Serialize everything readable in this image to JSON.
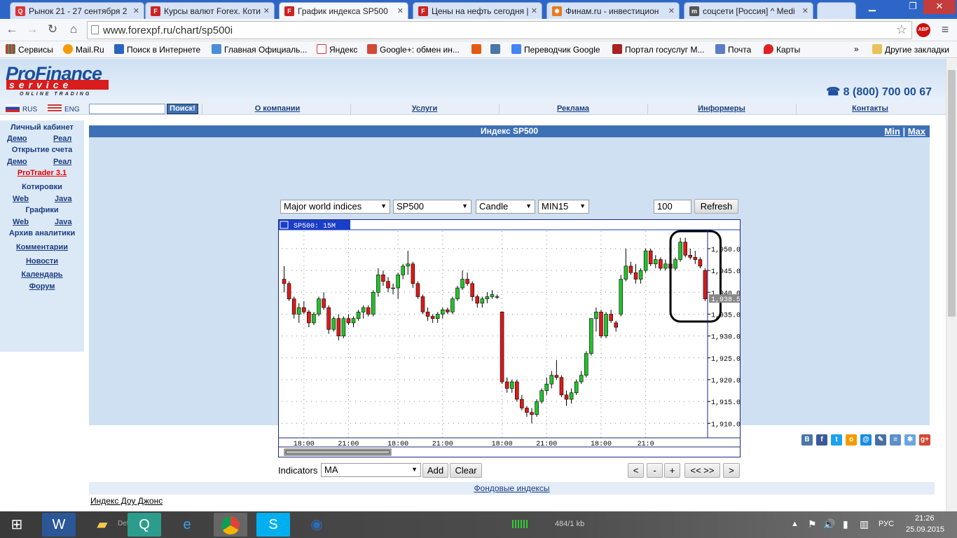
{
  "browser": {
    "tabs": [
      {
        "title": "Рынок 21 - 27 сентября 2",
        "icon": "qf-icon",
        "active": false
      },
      {
        "title": "Курсы валют Forex. Коти",
        "icon": "pf-icon",
        "active": false
      },
      {
        "title": "График индекса SP500",
        "icon": "pf-icon",
        "active": true
      },
      {
        "title": "Цены на нефть сегодня |",
        "icon": "pf-icon",
        "active": false
      },
      {
        "title": "Финам.ru - инвестицион",
        "icon": "finam-icon",
        "active": false
      },
      {
        "title": "соцсети [Россия] ^ Medi",
        "icon": "m-icon",
        "active": false
      }
    ],
    "url": "www.forexpf.ru/chart/sp500i",
    "bookmarks": [
      "Сервисы",
      "Mail.Ru",
      "Поиск в Интернете",
      "Главная Официаль...",
      "Яндекс",
      "Google+: обмен ин...",
      "",
      "",
      "Переводчик Google",
      "Портал госуслуг М...",
      "Почта",
      "Карты"
    ],
    "bookmarks_more": "»",
    "other_bookmarks": "Другие закладки",
    "abp_badge": "ABP"
  },
  "site": {
    "logo_top": "ProFinance",
    "logo_mid": "service",
    "logo_bottom": "ONLINE TRADING",
    "phone": "8 (800) 700 00 67",
    "lang_ru": "RUS",
    "lang_en": "ENG",
    "search_button": "Поиск!",
    "nav": [
      "О компании",
      "Услуги",
      "Реклама",
      "Информеры",
      "Контакты"
    ]
  },
  "sidebar": {
    "cabinet": "Личный кабинет",
    "demo1": "Демо",
    "real1": "Реал",
    "open_account": "Открытие счета",
    "demo2": "Демо",
    "real2": "Реал",
    "protrader": "ProTrader 3.1",
    "quotes": "Котировки",
    "web1": "Web",
    "java1": "Java",
    "charts": "Графики",
    "web2": "Web",
    "java2": "Java",
    "archive": "Архив аналитики",
    "comments": "Комментарии",
    "news": "Новости",
    "calendar": "Календарь",
    "forum": "Форум"
  },
  "main": {
    "title": "Индекс SP500",
    "min": "Min",
    "sep": "|",
    "max": "Max",
    "group_select": "Major world indices",
    "symbol_select": "SP500",
    "type_select": "Candle",
    "period_select": "MIN15",
    "count": "100",
    "refresh": "Refresh",
    "indicators_label": "Indicators",
    "indicator_select": "MA",
    "add": "Add",
    "clear": "Clear",
    "nav_prev": "<",
    "nav_minus": "-",
    "nav_plus": "+",
    "nav_expand": "<< >>",
    "nav_next": ">"
  },
  "chart_data": {
    "type": "candlestick",
    "legend": "SP500: 15M",
    "ylim": [
      1907,
      1954
    ],
    "y_ticks": [
      "1,910.00",
      "1,915.00",
      "1,920.00",
      "1,925.00",
      "1,930.00",
      "1,935.00",
      "1,940.00",
      "1,945.00",
      "1,950.00"
    ],
    "y_tick_values": [
      1910,
      1915,
      1920,
      1925,
      1930,
      1935,
      1940,
      1945,
      1950
    ],
    "x_ticks": [
      "18:00",
      "21:00",
      "18:00",
      "21:00",
      "18:00",
      "21:00",
      "18:00",
      "21:0"
    ],
    "x_tick_bars": [
      4,
      13,
      23,
      32,
      44,
      53,
      64,
      73
    ],
    "last_price_label": "1,938.57",
    "last_price": 1938.57,
    "candles": [
      [
        1943.0,
        1946.0,
        1940.0,
        1942.0
      ],
      [
        1942.0,
        1942.5,
        1938.0,
        1938.5
      ],
      [
        1938.5,
        1939.0,
        1934.0,
        1935.0
      ],
      [
        1935.0,
        1937.5,
        1933.0,
        1936.5
      ],
      [
        1936.5,
        1938.0,
        1935.0,
        1935.5
      ],
      [
        1935.5,
        1936.0,
        1932.0,
        1933.0
      ],
      [
        1933.0,
        1935.5,
        1932.5,
        1935.0
      ],
      [
        1935.0,
        1939.0,
        1934.5,
        1938.5
      ],
      [
        1938.5,
        1940.0,
        1936.0,
        1936.5
      ],
      [
        1936.5,
        1937.0,
        1930.5,
        1931.5
      ],
      [
        1931.5,
        1934.5,
        1931.0,
        1934.0
      ],
      [
        1934.0,
        1935.0,
        1929.0,
        1930.0
      ],
      [
        1930.0,
        1934.5,
        1929.5,
        1934.0
      ],
      [
        1934.0,
        1935.0,
        1932.5,
        1933.0
      ],
      [
        1933.0,
        1934.5,
        1932.0,
        1934.0
      ],
      [
        1934.0,
        1936.0,
        1933.5,
        1935.5
      ],
      [
        1935.5,
        1937.0,
        1934.0,
        1936.5
      ],
      [
        1936.5,
        1937.0,
        1934.5,
        1935.0
      ],
      [
        1935.0,
        1940.5,
        1934.5,
        1940.0
      ],
      [
        1940.0,
        1945.5,
        1939.0,
        1944.0
      ],
      [
        1944.0,
        1945.0,
        1941.5,
        1942.5
      ],
      [
        1942.5,
        1943.5,
        1940.0,
        1941.0
      ],
      [
        1941.0,
        1942.0,
        1939.5,
        1941.0
      ],
      [
        1941.0,
        1944.5,
        1938.5,
        1944.0
      ],
      [
        1944.0,
        1946.5,
        1943.0,
        1946.0
      ],
      [
        1946.0,
        1949.5,
        1944.0,
        1946.5
      ],
      [
        1946.5,
        1947.0,
        1941.0,
        1942.0
      ],
      [
        1942.0,
        1942.5,
        1938.5,
        1939.0
      ],
      [
        1939.0,
        1939.5,
        1935.0,
        1935.5
      ],
      [
        1935.5,
        1936.5,
        1933.5,
        1934.5
      ],
      [
        1934.5,
        1935.0,
        1933.0,
        1934.0
      ],
      [
        1934.0,
        1935.5,
        1933.0,
        1935.0
      ],
      [
        1935.0,
        1936.5,
        1934.0,
        1936.0
      ],
      [
        1936.0,
        1936.5,
        1935.0,
        1935.5
      ],
      [
        1935.5,
        1939.0,
        1935.0,
        1938.5
      ],
      [
        1938.5,
        1941.5,
        1938.0,
        1941.0
      ],
      [
        1941.0,
        1945.0,
        1940.5,
        1943.0
      ],
      [
        1943.0,
        1944.5,
        1941.5,
        1942.0
      ],
      [
        1942.0,
        1942.5,
        1938.0,
        1939.0
      ],
      [
        1939.0,
        1939.5,
        1936.5,
        1937.5
      ],
      [
        1937.5,
        1939.0,
        1936.5,
        1938.5
      ],
      [
        1938.5,
        1940.0,
        1937.5,
        1939.0
      ],
      [
        1939.0,
        1940.5,
        1938.5,
        1939.5
      ],
      [
        1939.0,
        1939.5,
        1938.5,
        1939.0
      ],
      [
        1935.5,
        1935.5,
        1919.0,
        1919.5
      ],
      [
        1919.5,
        1920.5,
        1917.0,
        1918.0
      ],
      [
        1918.0,
        1920.0,
        1917.0,
        1919.5
      ],
      [
        1919.5,
        1920.0,
        1915.0,
        1915.5
      ],
      [
        1915.5,
        1916.5,
        1913.0,
        1913.5
      ],
      [
        1913.5,
        1914.0,
        1911.5,
        1912.5
      ],
      [
        1912.5,
        1913.5,
        1910.0,
        1912.0
      ],
      [
        1912.0,
        1915.5,
        1911.5,
        1915.0
      ],
      [
        1915.0,
        1918.0,
        1914.5,
        1917.5
      ],
      [
        1917.5,
        1920.5,
        1916.5,
        1919.0
      ],
      [
        1919.0,
        1922.0,
        1918.0,
        1921.0
      ],
      [
        1921.0,
        1924.5,
        1920.0,
        1920.5
      ],
      [
        1920.5,
        1921.0,
        1916.0,
        1916.5
      ],
      [
        1916.5,
        1917.5,
        1914.0,
        1915.5
      ],
      [
        1915.5,
        1918.0,
        1914.5,
        1917.0
      ],
      [
        1917.0,
        1920.0,
        1916.5,
        1919.5
      ],
      [
        1919.5,
        1922.0,
        1919.0,
        1921.0
      ],
      [
        1921.0,
        1926.5,
        1920.5,
        1926.0
      ],
      [
        1926.0,
        1934.0,
        1925.5,
        1934.0
      ],
      [
        1934.0,
        1936.5,
        1931.0,
        1935.5
      ],
      [
        1935.5,
        1936.0,
        1929.5,
        1930.0
      ],
      [
        1930.0,
        1935.5,
        1929.5,
        1935.0
      ],
      [
        1935.0,
        1936.0,
        1933.0,
        1933.5
      ],
      [
        1933.0,
        1933.5,
        1931.0,
        1932.0
      ],
      [
        1935.0,
        1944.0,
        1934.5,
        1943.0
      ],
      [
        1943.0,
        1950.0,
        1942.5,
        1946.0
      ],
      [
        1946.0,
        1947.0,
        1944.0,
        1944.5
      ],
      [
        1944.5,
        1946.5,
        1942.0,
        1943.0
      ],
      [
        1943.0,
        1945.5,
        1942.0,
        1945.0
      ],
      [
        1945.0,
        1950.0,
        1944.5,
        1949.5
      ],
      [
        1949.5,
        1950.0,
        1946.0,
        1946.5
      ],
      [
        1946.5,
        1948.5,
        1945.5,
        1947.5
      ],
      [
        1947.5,
        1948.0,
        1945.0,
        1945.5
      ],
      [
        1945.5,
        1947.5,
        1945.0,
        1946.5
      ],
      [
        1946.5,
        1947.0,
        1943.0,
        1945.5
      ],
      [
        1945.5,
        1948.0,
        1945.0,
        1947.5
      ],
      [
        1947.5,
        1952.5,
        1947.0,
        1951.5
      ],
      [
        1951.5,
        1952.5,
        1948.0,
        1948.5
      ],
      [
        1948.5,
        1950.0,
        1947.5,
        1948.0
      ],
      [
        1948.0,
        1949.5,
        1946.5,
        1947.5
      ],
      [
        1947.5,
        1948.0,
        1945.5,
        1946.0
      ],
      [
        1945.0,
        1945.5,
        1938.0,
        1938.5
      ]
    ]
  },
  "footer": {
    "section_link": "Фондовые индексы",
    "dow_link": "Индекс Доу Джонс"
  },
  "taskbar": {
    "network_status": "484/1 kb",
    "lang": "РУС",
    "time": "21:26",
    "date": "25.09.2015",
    "def_label": "Defa"
  }
}
